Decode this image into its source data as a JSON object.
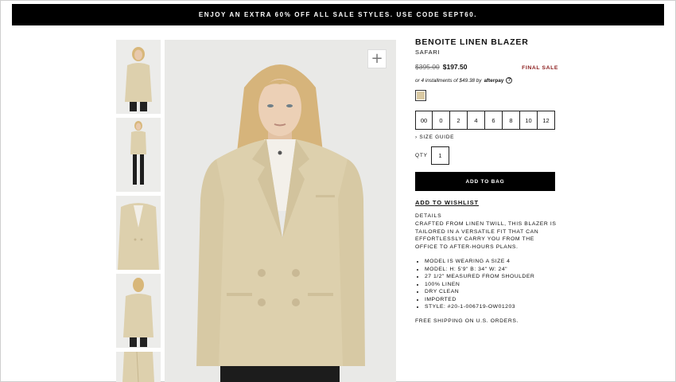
{
  "promo_banner": "ENJOY AN EXTRA 60% OFF ALL SALE STYLES. USE CODE SEPT60.",
  "product": {
    "name": "BENOITE LINEN BLAZER",
    "color_name": "SAFARI",
    "price_original": "$395.00",
    "price_sale": "$197.50",
    "badge": "FINAL SALE",
    "afterpay_text": "or 4 installments of $49.38 by",
    "afterpay_logo": "afterpay",
    "afterpay_help": "?",
    "swatch_color": "#d9c9a3",
    "sizes": [
      "00",
      "0",
      "2",
      "4",
      "6",
      "8",
      "10",
      "12"
    ],
    "size_guide": "› SIZE GUIDE",
    "qty_label": "QTY",
    "qty_value": "1",
    "add_to_bag": "ADD TO BAG",
    "add_to_wishlist": "ADD TO WISHLIST",
    "details_heading": "DETAILS",
    "details_text": "CRAFTED FROM LINEN TWILL, THIS BLAZER IS TAILORED IN A VERSATILE FIT THAT CAN EFFORTLESSLY CARRY YOU FROM THE OFFICE TO AFTER-HOURS PLANS.",
    "bullets": [
      "MODEL IS WEARING A SIZE 4",
      "MODEL: H: 5'9\" B: 34\" W: 24\"",
      "27 1/2\" MEASURED FROM SHOULDER",
      "100% LINEN",
      "DRY CLEAN",
      "IMPORTED",
      "STYLE: #20-1-006719-OW01203"
    ],
    "shipping": "FREE SHIPPING ON U.S. ORDERS."
  },
  "gallery": {
    "zoom_icon": "+",
    "thumbnail_count": 5
  },
  "colors": {
    "blazer": "#ddd0ad",
    "final_sale": "#8b1c1c",
    "background_photo": "#e9e9e7"
  }
}
